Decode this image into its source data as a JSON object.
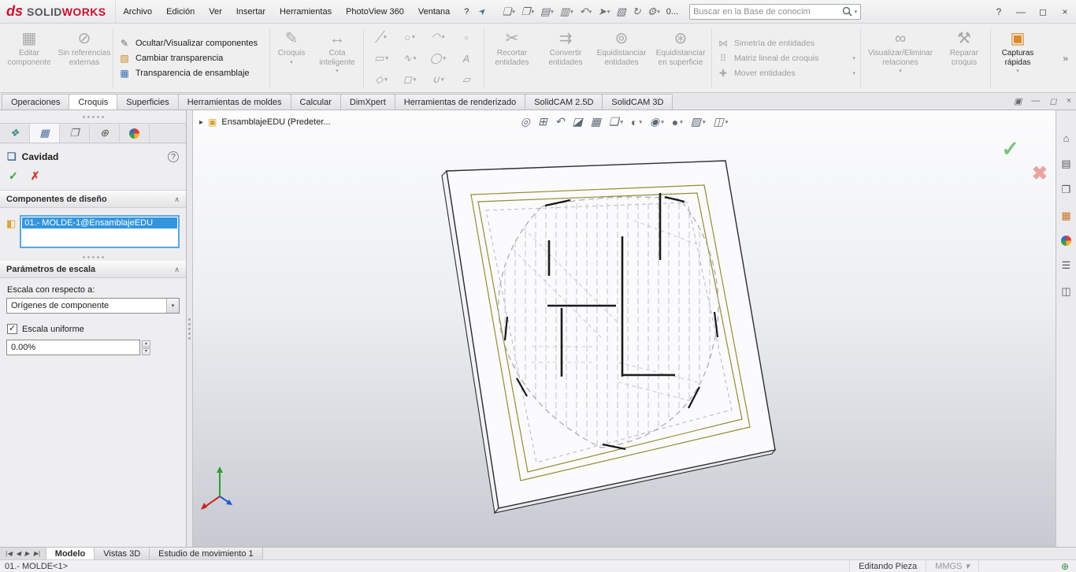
{
  "titlebar": {
    "brand_ds": "ds",
    "brand_solid": "SOLID",
    "brand_works": "WORKS",
    "menus": [
      "Archivo",
      "Edición",
      "Ver",
      "Insertar",
      "Herramientas",
      "PhotoView 360",
      "Ventana",
      "?"
    ],
    "overflow": "0...",
    "search_placeholder": "Buscar en la Base de conocim"
  },
  "ribbon": {
    "edit_component": "Editar componente",
    "no_external_refs": "Sin referencias externas",
    "hide_show_components": "Ocultar/Visualizar componentes",
    "change_transparency": "Cambiar transparencia",
    "assembly_transparency": "Transparencia de ensamblaje",
    "sketch": "Croquis",
    "smart_dimension": "Cota inteligente",
    "trim_entities": "Recortar entidades",
    "convert_entities": "Convertir entidades",
    "offset_entities": "Equidistanciar entidades",
    "offset_on_surface": "Equidistanciar en superficie",
    "mirror_entities": "Simetría de entidades",
    "linear_sketch_pattern": "Matriz lineal de croquis",
    "move_entities": "Mover entidades",
    "display_delete_relations": "Visualizar/Eliminar relaciones",
    "repair_sketch": "Reparar croquis",
    "instant_snapshots": "Capturas rápidas",
    "expand": "»"
  },
  "command_tabs": [
    "Operaciones",
    "Croquis",
    "Superficies",
    "Herramientas de moldes",
    "Calcular",
    "DimXpert",
    "Herramientas de renderizado",
    "SolidCAM 2.5D",
    "SolidCAM 3D"
  ],
  "active_command_tab": "Croquis",
  "property_manager": {
    "title": "Cavidad",
    "design_components_header": "Componentes de diseño",
    "selected_component": "01.- MOLDE-1@EnsamblajeEDU",
    "scale_header": "Parámetros de escala",
    "scale_about_label": "Escala con respecto a:",
    "scale_about_value": "Orígenes de componente",
    "uniform_scale_label": "Escala uniforme",
    "scale_value": "0.00%",
    "uniform_scale_checked": true
  },
  "viewport": {
    "breadcrumb": "EnsamblajeEDU  (Predeter..."
  },
  "model_tabs": {
    "nav": [
      "|◀",
      "◀",
      "▶",
      "▶|"
    ],
    "items": [
      "Modelo",
      "Vistas 3D",
      "Estudio de movimiento 1"
    ],
    "active": "Modelo"
  },
  "statusbar": {
    "selection": "01.- MOLDE<1>",
    "mode": "Editando Pieza",
    "units": "MMGS"
  },
  "colors": {
    "brand_red": "#c8102e",
    "selection_blue": "#3396dd",
    "confirm_green": "#7cc47c",
    "cancel_red": "#e9a5a0",
    "sketch_frame_olive": "#8f8f33"
  },
  "icons": {
    "pin": "➤",
    "new": "❏",
    "open": "❒",
    "save": "▤",
    "print": "▥",
    "undo": "↶",
    "select_arrow": "➤",
    "clipboard": "▧",
    "rebuild": "↻",
    "gear": "⚙",
    "caret": "▾",
    "chevron": "∧",
    "help": "?",
    "win_min": "—",
    "win_max": "◻",
    "win_close": "×",
    "dock": "▣",
    "doc_min": "—",
    "doc_restore": "◻",
    "doc_close": "×",
    "edit_component": "▦",
    "no_ext_ref": "⊘",
    "hide_show": "✎",
    "transparency": "▨",
    "asm_transparency": "▦",
    "sketch": "✎",
    "dimension": "↔",
    "line": "╱",
    "circle": "○",
    "arc": "◠",
    "rect": "▭",
    "spline": "∿",
    "ellipse": "◯",
    "text_tool": "A",
    "slot": "◻",
    "polygon": "◇",
    "fillet": "∪",
    "grid_a": "▫",
    "grid_b": "▱",
    "trim": "✂",
    "convert": "⇉",
    "offset": "⊚",
    "offset_surface": "⊛",
    "mirror": "⋈",
    "linear_pattern": "⠿",
    "move": "✚",
    "relations": "∞",
    "repair": "⚒",
    "snapshot": "▣",
    "pm_tree": "❖",
    "pm_prop": "▦",
    "pm_config": "❐",
    "pm_dim": "⊕",
    "feature_cavity": "❏",
    "component": "◧",
    "ok": "✓",
    "cancel": "✗",
    "big_ok": "✓",
    "big_cancel": "✖",
    "bc_arrow": "▸",
    "assembly": "▣",
    "hud": [
      "◎",
      "⊞",
      "↶",
      "◪",
      "▦",
      "❏",
      "◐",
      "◉",
      "●",
      "▨",
      "◫"
    ],
    "home": "⌂",
    "library": "▤",
    "explorer": "❒",
    "palette": "▦",
    "props": "☰",
    "pane": "◫",
    "nav": "",
    "globe": "⊕",
    "spin_up": "▴",
    "spin_down": "▾"
  }
}
